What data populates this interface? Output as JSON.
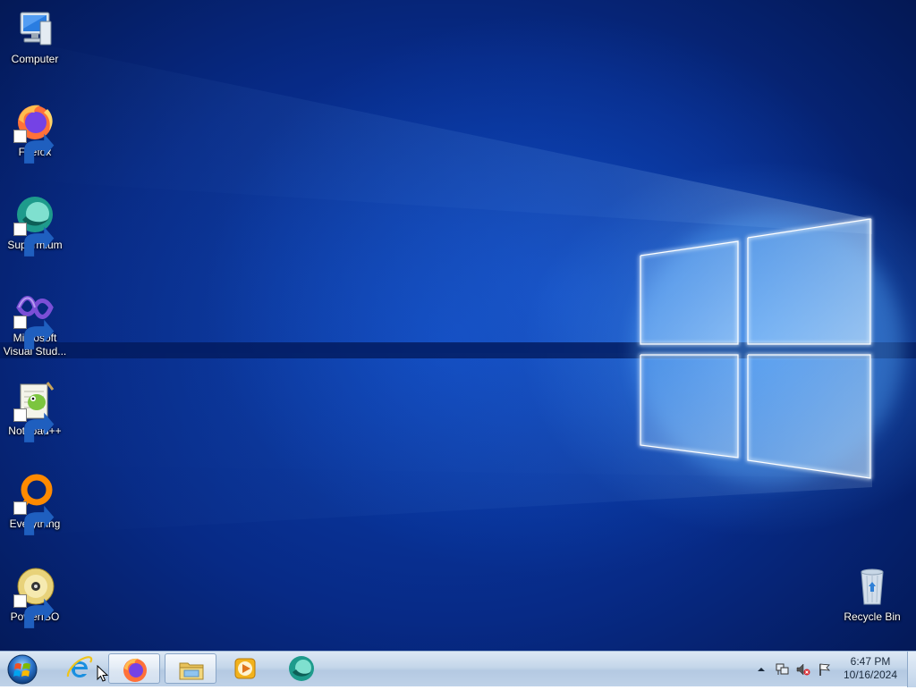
{
  "desktop": {
    "icons": [
      {
        "label": "Computer",
        "icon": "computer-icon",
        "shortcut": false
      },
      {
        "label": "Firefox",
        "icon": "firefox-icon",
        "shortcut": true
      },
      {
        "label": "Supermium",
        "icon": "supermium-icon",
        "shortcut": true
      },
      {
        "label": "Microsoft Visual Stud...",
        "icon": "visual-studio-icon",
        "shortcut": true
      },
      {
        "label": "Notepad++",
        "icon": "notepad-plus-plus-icon",
        "shortcut": true
      },
      {
        "label": "Everything",
        "icon": "everything-search-icon",
        "shortcut": true
      },
      {
        "label": "PowerISO",
        "icon": "poweriso-icon",
        "shortcut": true
      }
    ],
    "recycle_bin": {
      "label": "Recycle Bin",
      "icon": "recycle-bin-icon"
    }
  },
  "taskbar": {
    "start": {
      "icon": "windows-start-orb-icon"
    },
    "pinned": [
      {
        "name": "Internet Explorer",
        "icon": "internet-explorer-icon",
        "active": false
      },
      {
        "name": "Firefox",
        "icon": "firefox-icon",
        "active": true
      },
      {
        "name": "Windows Explorer",
        "icon": "file-explorer-icon",
        "active": true
      },
      {
        "name": "Windows Media Player",
        "icon": "media-player-icon",
        "active": false
      },
      {
        "name": "Supermium",
        "icon": "supermium-icon",
        "active": false
      }
    ],
    "tray": {
      "icons": [
        "show-hidden-icons-arrow-icon",
        "network-icon",
        "volume-muted-icon",
        "action-center-flag-icon"
      ]
    },
    "clock": {
      "time": "6:47 PM",
      "date": "10/16/2024"
    }
  },
  "colors": {
    "wallpaper_dark": "#02103a",
    "wallpaper_mid": "#0a3fb0",
    "light_beam": "#cfe8ff",
    "taskbar": "#c4d6ea"
  }
}
